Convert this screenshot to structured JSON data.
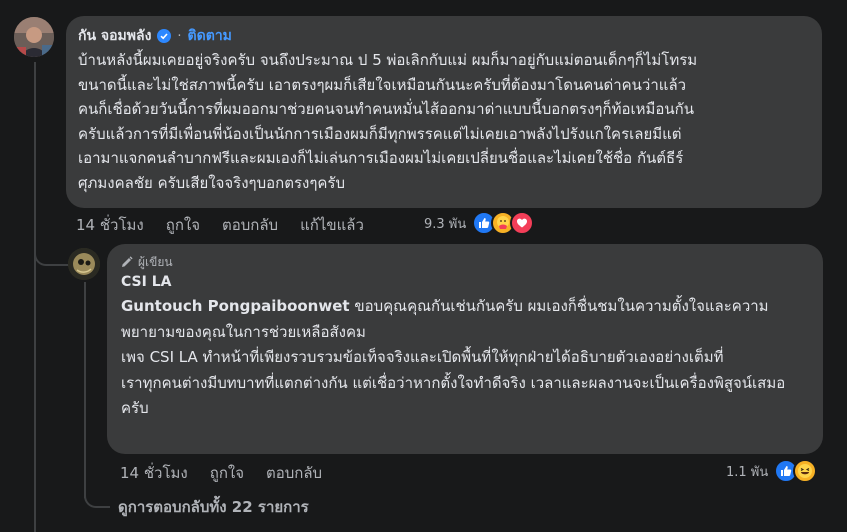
{
  "main_comment": {
    "author": "กัน จอมพลัง",
    "follow_label": "ติดตาม",
    "separator": "·",
    "text": "บ้านหลังนี้ผมเคยอยู่จริงครับ จนถึงประมาณ ป 5 พ่อเลิกกับแม่ ผมก็มาอยู่กับแม่ตอนเด็กๆก็ไม่โทรม\nขนาดนี้และไม่ใช่สภาพนี้ครับ เอาตรงๆผมก็เสียใจเหมือนกันนะครับที่ต้องมาโดนคนด่าคนว่าแล้ว\nคนก็เชื่อด้วยวันนี้การที่ผมออกมาช่วยคนจนทำคนหมั่นไส้ออกมาด่าแบบนี้บอกตรงๆก็ท้อเหมือนกัน\nครับแล้วการที่มีเพื่อนพี่น้องเป็นนักการเมืองผมก็มีทุกพรรคแต่ไม่เคยเอาพลังไปรังแกใครเลยมีแต่\nเอามาแจกคนลำบากฟรีและผมเองก็ไม่เล่นการเมืองผมไม่เคยเปลี่ยนชื่อและไม่เคยใช้ชื่อ กันต์ธีร์\nศุภมงคลชัย ครับเสียใจจริงๆบอกตรงๆครับ",
    "time": "14 ชั่วโมง",
    "like_label": "ถูกใจ",
    "reply_label": "ตอบกลับ",
    "edited_label": "แก้ไขแล้ว",
    "reaction_count": "9.3 พัน",
    "reactions": [
      "like-icon",
      "care-icon",
      "love-icon"
    ]
  },
  "reply_comment": {
    "author_badge": "ผู้เขียน",
    "author": "CSI LA",
    "mention": "Guntouch Pongpaiboonwet",
    "paragraphs": [
      "ขอบคุณคุณกันเช่นกันครับ ผมเองก็ชื่นชมในความตั้งใจและความพยายามของคุณในการช่วยเหลือสังคม",
      "เพจ CSI LA ทำหน้าที่เพียงรวบรวมข้อเท็จจริงและเปิดพื้นที่ให้ทุกฝ่ายได้อธิบายตัวเองอย่างเต็มที่",
      "เราทุกคนต่างมีบทบาทที่แตกต่างกัน แต่เชื่อว่าหากตั้งใจทำดีจริง เวลาและผลงานจะเป็นเครื่องพิสูจน์เสมอครับ"
    ],
    "time": "14 ชั่วโมง",
    "like_label": "ถูกใจ",
    "reply_label": "ตอบกลับ",
    "reaction_count": "1.1 พัน",
    "reactions": [
      "like-icon",
      "haha-icon"
    ]
  },
  "view_replies_label": "ดูการตอบกลับทั้ง 22 รายการ",
  "colors": {
    "background": "#18191a",
    "bubble": "#3a3b3c",
    "link": "#4599ff",
    "secondary_text": "#b0b3b8",
    "like": "#2078f4",
    "love": "#f33e58",
    "care": "#f7b125"
  }
}
